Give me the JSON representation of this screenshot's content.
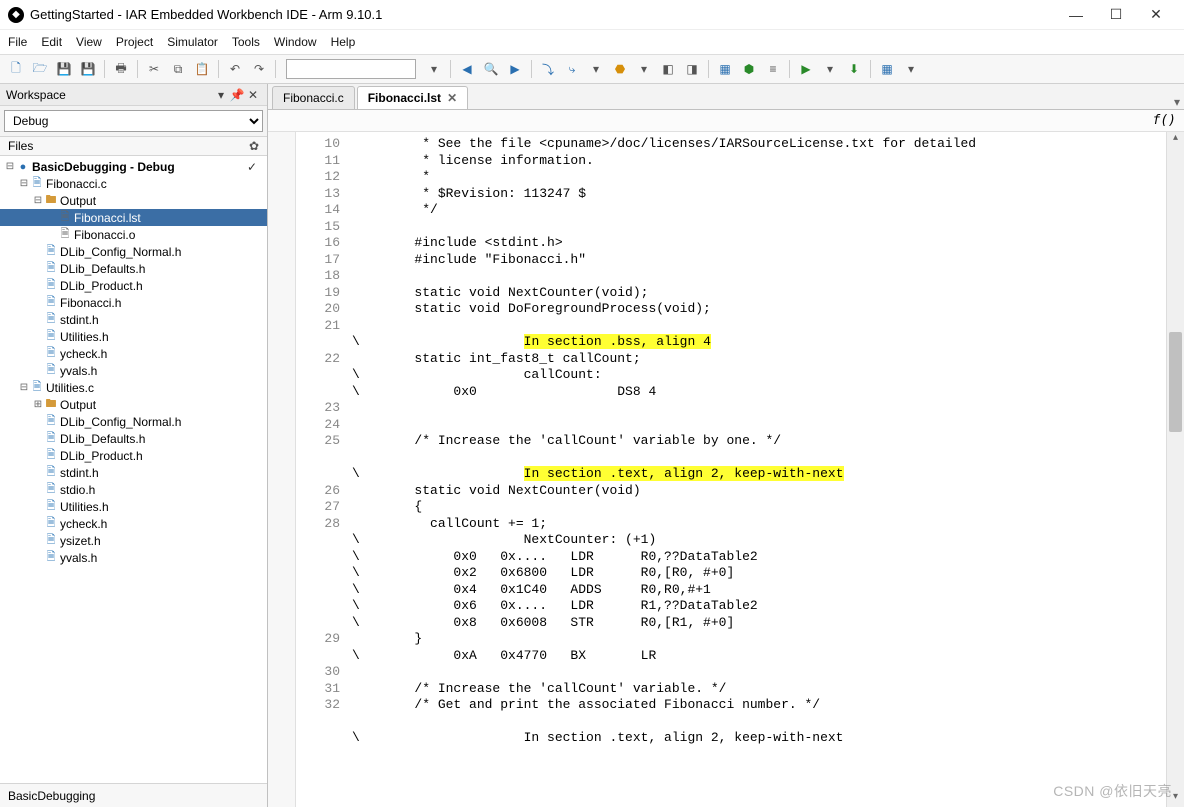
{
  "window": {
    "title": "GettingStarted - IAR Embedded Workbench IDE - Arm 9.10.1",
    "app_icon": "◆"
  },
  "menubar": [
    "File",
    "Edit",
    "View",
    "Project",
    "Simulator",
    "Tools",
    "Window",
    "Help"
  ],
  "workspace": {
    "title": "Workspace",
    "config": "Debug",
    "files_header": "Files",
    "footer_tab": "BasicDebugging",
    "tree": [
      {
        "depth": 0,
        "exp": "⊟",
        "icon": "●",
        "iconClass": "proj",
        "label": "BasicDebugging - Debug",
        "bold": true,
        "check": true
      },
      {
        "depth": 1,
        "exp": "⊟",
        "icon": "🗎",
        "iconClass": "file-c",
        "label": "Fibonacci.c"
      },
      {
        "depth": 2,
        "exp": "⊟",
        "icon": "🖿",
        "iconClass": "folder",
        "label": "Output"
      },
      {
        "depth": 3,
        "exp": "",
        "icon": "🗎",
        "iconClass": "file-lst",
        "label": "Fibonacci.lst",
        "selected": true
      },
      {
        "depth": 3,
        "exp": "",
        "icon": "🗎",
        "iconClass": "file-o",
        "label": "Fibonacci.o"
      },
      {
        "depth": 2,
        "exp": "",
        "icon": "🗎",
        "iconClass": "file-h",
        "label": "DLib_Config_Normal.h"
      },
      {
        "depth": 2,
        "exp": "",
        "icon": "🗎",
        "iconClass": "file-h",
        "label": "DLib_Defaults.h"
      },
      {
        "depth": 2,
        "exp": "",
        "icon": "🗎",
        "iconClass": "file-h",
        "label": "DLib_Product.h"
      },
      {
        "depth": 2,
        "exp": "",
        "icon": "🗎",
        "iconClass": "file-h",
        "label": "Fibonacci.h"
      },
      {
        "depth": 2,
        "exp": "",
        "icon": "🗎",
        "iconClass": "file-h",
        "label": "stdint.h"
      },
      {
        "depth": 2,
        "exp": "",
        "icon": "🗎",
        "iconClass": "file-h",
        "label": "Utilities.h"
      },
      {
        "depth": 2,
        "exp": "",
        "icon": "🗎",
        "iconClass": "file-h",
        "label": "ycheck.h"
      },
      {
        "depth": 2,
        "exp": "",
        "icon": "🗎",
        "iconClass": "file-h",
        "label": "yvals.h"
      },
      {
        "depth": 1,
        "exp": "⊟",
        "icon": "🗎",
        "iconClass": "file-c",
        "label": "Utilities.c"
      },
      {
        "depth": 2,
        "exp": "⊞",
        "icon": "🖿",
        "iconClass": "folder",
        "label": "Output"
      },
      {
        "depth": 2,
        "exp": "",
        "icon": "🗎",
        "iconClass": "file-h",
        "label": "DLib_Config_Normal.h"
      },
      {
        "depth": 2,
        "exp": "",
        "icon": "🗎",
        "iconClass": "file-h",
        "label": "DLib_Defaults.h"
      },
      {
        "depth": 2,
        "exp": "",
        "icon": "🗎",
        "iconClass": "file-h",
        "label": "DLib_Product.h"
      },
      {
        "depth": 2,
        "exp": "",
        "icon": "🗎",
        "iconClass": "file-h",
        "label": "stdint.h"
      },
      {
        "depth": 2,
        "exp": "",
        "icon": "🗎",
        "iconClass": "file-h",
        "label": "stdio.h"
      },
      {
        "depth": 2,
        "exp": "",
        "icon": "🗎",
        "iconClass": "file-h",
        "label": "Utilities.h"
      },
      {
        "depth": 2,
        "exp": "",
        "icon": "🗎",
        "iconClass": "file-h",
        "label": "ycheck.h"
      },
      {
        "depth": 2,
        "exp": "",
        "icon": "🗎",
        "iconClass": "file-h",
        "label": "ysizet.h"
      },
      {
        "depth": 2,
        "exp": "",
        "icon": "🗎",
        "iconClass": "file-h",
        "label": "yvals.h"
      }
    ]
  },
  "tabs": [
    {
      "label": "Fibonacci.c",
      "active": false
    },
    {
      "label": "Fibonacci.lst",
      "active": true
    }
  ],
  "fo_symbol": "f()",
  "code_lines": [
    {
      "ln": "10",
      "text": "         * See the file <cpuname>/doc/licenses/IARSourceLicense.txt for detailed"
    },
    {
      "ln": "11",
      "text": "         * license information."
    },
    {
      "ln": "12",
      "text": "         *"
    },
    {
      "ln": "13",
      "text": "         * $Revision: 113247 $"
    },
    {
      "ln": "14",
      "text": "         */"
    },
    {
      "ln": "15",
      "text": ""
    },
    {
      "ln": "16",
      "text": "        #include <stdint.h>"
    },
    {
      "ln": "17",
      "text": "        #include \"Fibonacci.h\""
    },
    {
      "ln": "18",
      "text": ""
    },
    {
      "ln": "19",
      "text": "        static void NextCounter(void);"
    },
    {
      "ln": "20",
      "text": "        static void DoForegroundProcess(void);"
    },
    {
      "ln": "21",
      "text": ""
    },
    {
      "ln": "",
      "text": "\\                     ",
      "hl": "In section .bss, align 4"
    },
    {
      "ln": "22",
      "text": "        static int_fast8_t callCount;"
    },
    {
      "ln": "",
      "text": "\\                     callCount:"
    },
    {
      "ln": "",
      "text": "\\            0x0                  DS8 4"
    },
    {
      "ln": "23",
      "text": ""
    },
    {
      "ln": "24",
      "text": ""
    },
    {
      "ln": "25",
      "text": "        /* Increase the 'callCount' variable by one. */"
    },
    {
      "ln": "",
      "text": ""
    },
    {
      "ln": "",
      "text": "\\                     ",
      "hl": "In section .text, align 2, keep-with-next"
    },
    {
      "ln": "26",
      "text": "        static void NextCounter(void)"
    },
    {
      "ln": "27",
      "text": "        {"
    },
    {
      "ln": "28",
      "text": "          callCount += 1;"
    },
    {
      "ln": "",
      "text": "\\                     NextCounter: (+1)"
    },
    {
      "ln": "",
      "text": "\\            0x0   0x....   LDR      R0,??DataTable2"
    },
    {
      "ln": "",
      "text": "\\            0x2   0x6800   LDR      R0,[R0, #+0]"
    },
    {
      "ln": "",
      "text": "\\            0x4   0x1C40   ADDS     R0,R0,#+1"
    },
    {
      "ln": "",
      "text": "\\            0x6   0x....   LDR      R1,??DataTable2"
    },
    {
      "ln": "",
      "text": "\\            0x8   0x6008   STR      R0,[R1, #+0]"
    },
    {
      "ln": "29",
      "text": "        }"
    },
    {
      "ln": "",
      "text": "\\            0xA   0x4770   BX       LR"
    },
    {
      "ln": "30",
      "text": ""
    },
    {
      "ln": "31",
      "text": "        /* Increase the 'callCount' variable. */"
    },
    {
      "ln": "32",
      "text": "        /* Get and print the associated Fibonacci number. */"
    },
    {
      "ln": "",
      "text": ""
    },
    {
      "ln": "",
      "text": "\\                     In section .text, align 2, keep-with-next"
    }
  ],
  "watermark": "CSDN @依旧天亮"
}
